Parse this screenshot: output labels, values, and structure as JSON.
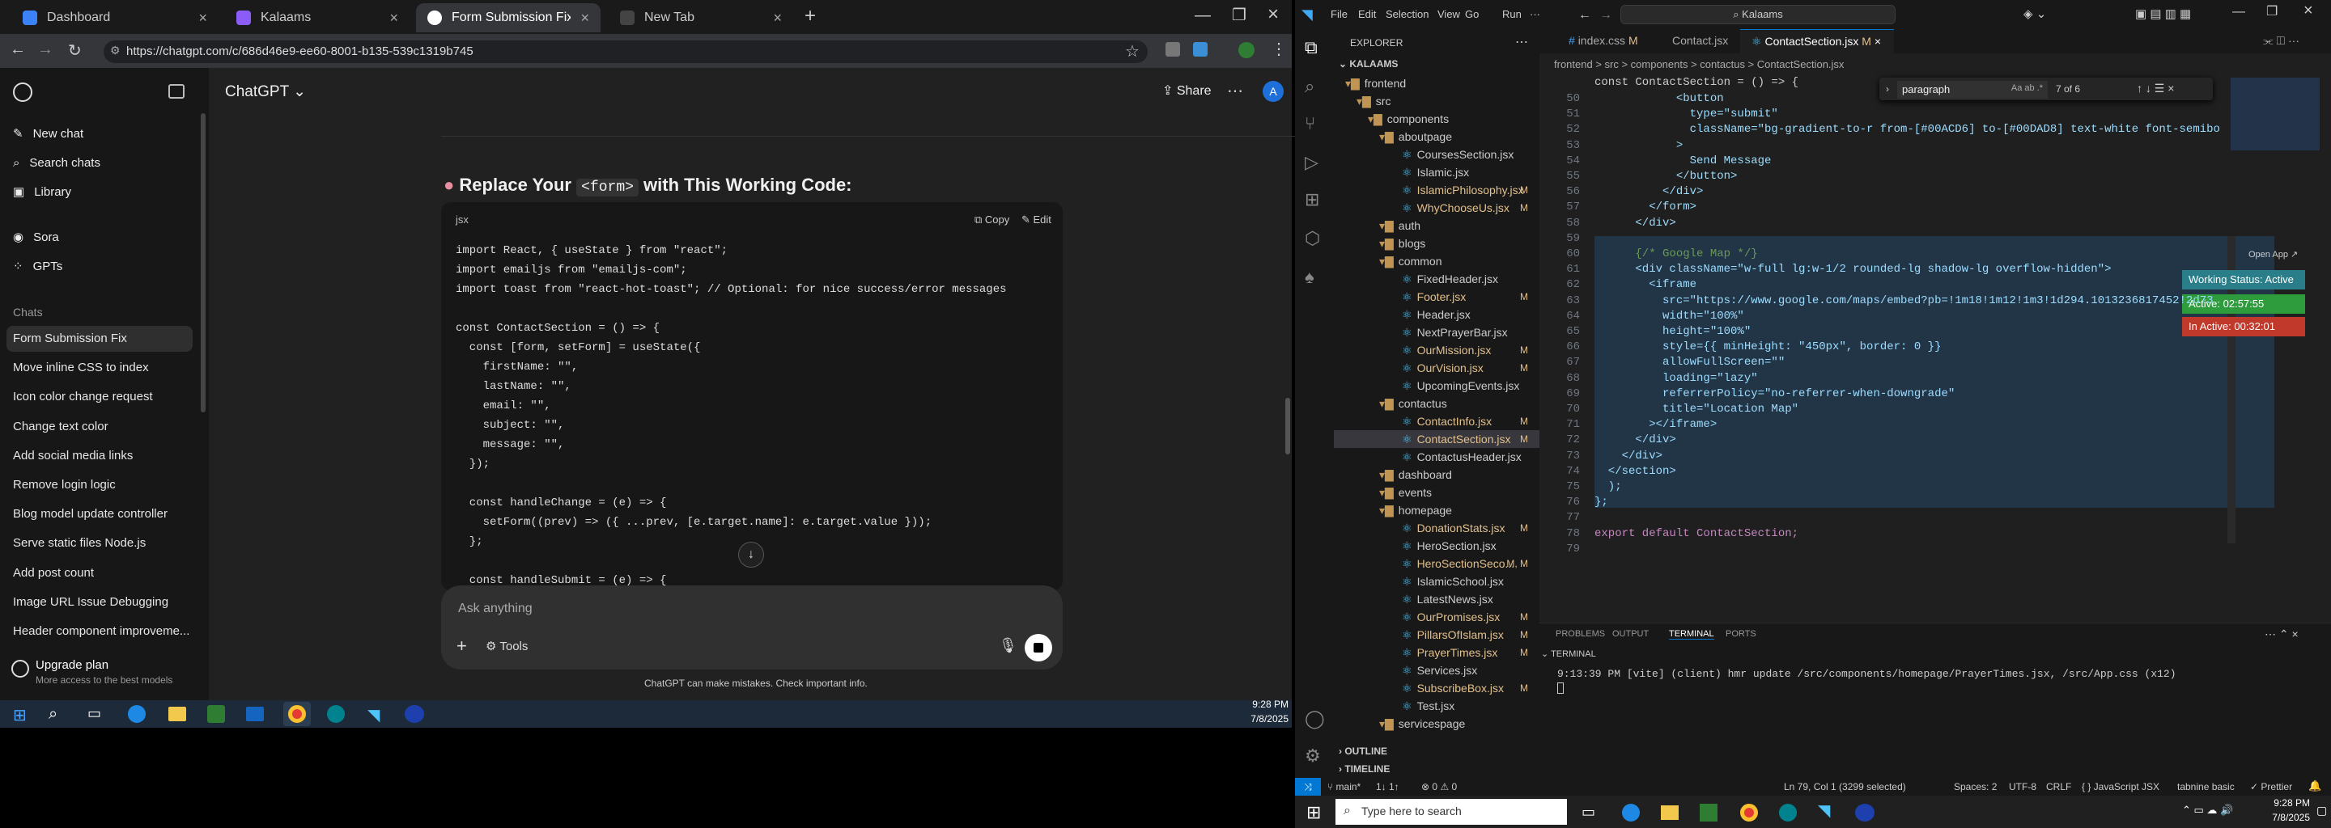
{
  "browser": {
    "tabs": [
      {
        "label": "Dashboard",
        "active": false
      },
      {
        "label": "Kalaams",
        "active": false
      },
      {
        "label": "Form Submission Fix",
        "active": true
      },
      {
        "label": "New Tab",
        "active": false
      }
    ],
    "url": "https://chatgpt.com/c/686d46e9-ee60-8001-b135-539c1319b745"
  },
  "chatgpt": {
    "model": "ChatGPT",
    "share_label": "Share",
    "avatar": "A",
    "nav": [
      {
        "label": "New chat",
        "icon": "new-chat-icon"
      },
      {
        "label": "Search chats",
        "icon": "search-icon"
      },
      {
        "label": "Library",
        "icon": "library-icon"
      },
      {
        "label": "Sora",
        "icon": "sora-icon"
      },
      {
        "label": "GPTs",
        "icon": "gpts-icon"
      }
    ],
    "chats_heading": "Chats",
    "chats": [
      "Form Submission Fix",
      "Move inline CSS to index",
      "Icon color change request",
      "Change text color",
      "Add social media links",
      "Remove login logic",
      "Blog model update controller",
      "Serve static files Node.js",
      "Add post count",
      "Image URL Issue Debugging",
      "Header component improveme..."
    ],
    "upgrade_title": "Upgrade plan",
    "upgrade_sub": "More access to the best models",
    "heading_pre": "Replace Your ",
    "heading_code": "<form>",
    "heading_post": " with This Working Code:",
    "code_lang": "jsx",
    "copy_label": "Copy",
    "edit_label": "Edit",
    "code_lines": [
      "import React, { useState } from \"react\";",
      "import emailjs from \"emailjs-com\";",
      "import toast from \"react-hot-toast\"; // Optional: for nice success/error messages",
      "",
      "const ContactSection = () => {",
      "  const [form, setForm] = useState({",
      "    firstName: \"\",",
      "    lastName: \"\",",
      "    email: \"\",",
      "    subject: \"\",",
      "    message: \"\",",
      "  });",
      "",
      "  const handleChange = (e) => {",
      "    setForm((prev) => ({ ...prev, [e.target.name]: e.target.value }));",
      "  };",
      "",
      "  const handleSubmit = (e) => {"
    ],
    "composer_placeholder": "Ask anything",
    "tools_label": "Tools",
    "disclaimer": "ChatGPT can make mistakes. Check important info."
  },
  "taskbar_left": {
    "time": "9:28 PM",
    "date": "7/8/2025"
  },
  "vscode": {
    "title_menu": [
      "File",
      "Edit",
      "Selection",
      "View",
      "Go",
      "Run",
      "···"
    ],
    "search_text": "Kalaams",
    "tabs": [
      {
        "label": "index.css",
        "mark": "M"
      },
      {
        "label": "Contact.jsx",
        "mark": ""
      },
      {
        "label": "ContactSection.jsx",
        "mark": "M"
      }
    ],
    "breadcrumb": "frontend > src > components > contactus > ContactSection.jsx",
    "find_text": "paragraph",
    "find_count": "7 of 6",
    "explorer_title": "EXPLORER",
    "root": "KALAAMS",
    "tree": [
      {
        "label": "frontend",
        "level": 1,
        "folder": true,
        "mark": ""
      },
      {
        "label": "src",
        "level": 2,
        "folder": true,
        "mark": ""
      },
      {
        "label": "components",
        "level": 3,
        "folder": true,
        "mark": ""
      },
      {
        "label": "aboutpage",
        "level": 4,
        "folder": true,
        "mark": ""
      },
      {
        "label": "CoursesSection.jsx",
        "level": 5,
        "folder": false,
        "mark": ""
      },
      {
        "label": "Islamic.jsx",
        "level": 5,
        "folder": false,
        "mark": ""
      },
      {
        "label": "IslamicPhilosophy.jsx",
        "level": 5,
        "folder": false,
        "mark": "M"
      },
      {
        "label": "WhyChooseUs.jsx",
        "level": 5,
        "folder": false,
        "mark": "M"
      },
      {
        "label": "auth",
        "level": 4,
        "folder": true,
        "mark": ""
      },
      {
        "label": "blogs",
        "level": 4,
        "folder": true,
        "mark": ""
      },
      {
        "label": "common",
        "level": 4,
        "folder": true,
        "mark": ""
      },
      {
        "label": "FixedHeader.jsx",
        "level": 5,
        "folder": false,
        "mark": ""
      },
      {
        "label": "Footer.jsx",
        "level": 5,
        "folder": false,
        "mark": "M"
      },
      {
        "label": "Header.jsx",
        "level": 5,
        "folder": false,
        "mark": ""
      },
      {
        "label": "NextPrayerBar.jsx",
        "level": 5,
        "folder": false,
        "mark": ""
      },
      {
        "label": "OurMission.jsx",
        "level": 5,
        "folder": false,
        "mark": "M"
      },
      {
        "label": "OurVision.jsx",
        "level": 5,
        "folder": false,
        "mark": "M"
      },
      {
        "label": "UpcomingEvents.jsx",
        "level": 5,
        "folder": false,
        "mark": ""
      },
      {
        "label": "contactus",
        "level": 4,
        "folder": true,
        "mark": ""
      },
      {
        "label": "ContactInfo.jsx",
        "level": 5,
        "folder": false,
        "mark": "M"
      },
      {
        "label": "ContactSection.jsx",
        "level": 5,
        "folder": false,
        "mark": "M"
      },
      {
        "label": "ContactusHeader.jsx",
        "level": 5,
        "folder": false,
        "mark": ""
      },
      {
        "label": "dashboard",
        "level": 4,
        "folder": true,
        "mark": ""
      },
      {
        "label": "events",
        "level": 4,
        "folder": true,
        "mark": ""
      },
      {
        "label": "homepage",
        "level": 4,
        "folder": true,
        "mark": ""
      },
      {
        "label": "DonationStats.jsx",
        "level": 5,
        "folder": false,
        "mark": "M"
      },
      {
        "label": "HeroSection.jsx",
        "level": 5,
        "folder": false,
        "mark": ""
      },
      {
        "label": "HeroSectionSeco...",
        "level": 5,
        "folder": false,
        "mark": "M, M"
      },
      {
        "label": "IslamicSchool.jsx",
        "level": 5,
        "folder": false,
        "mark": ""
      },
      {
        "label": "LatestNews.jsx",
        "level": 5,
        "folder": false,
        "mark": ""
      },
      {
        "label": "OurPromises.jsx",
        "level": 5,
        "folder": false,
        "mark": "M"
      },
      {
        "label": "PillarsOfIslam.jsx",
        "level": 5,
        "folder": false,
        "mark": "M"
      },
      {
        "label": "PrayerTimes.jsx",
        "level": 5,
        "folder": false,
        "mark": "M"
      },
      {
        "label": "Services.jsx",
        "level": 5,
        "folder": false,
        "mark": ""
      },
      {
        "label": "SubscribeBox.jsx",
        "level": 5,
        "folder": false,
        "mark": "M"
      },
      {
        "label": "Test.jsx",
        "level": 5,
        "folder": false,
        "mark": ""
      },
      {
        "label": "servicespage",
        "level": 4,
        "folder": true,
        "mark": ""
      }
    ],
    "outline": "OUTLINE",
    "timeline": "TIMELINE",
    "editor_lines": [
      {
        "n": "50",
        "t": "            <button"
      },
      {
        "n": "51",
        "t": "              type=\"submit\""
      },
      {
        "n": "52",
        "t": "              className=\"bg-gradient-to-r from-[#00ACD6] to-[#00DAD8] text-white font-semibo"
      },
      {
        "n": "53",
        "t": "            >"
      },
      {
        "n": "54",
        "t": "              Send Message"
      },
      {
        "n": "55",
        "t": "            </button>"
      },
      {
        "n": "56",
        "t": "          </div>"
      },
      {
        "n": "57",
        "t": "        </form>"
      },
      {
        "n": "58",
        "t": "      </div>"
      },
      {
        "n": "59",
        "t": ""
      },
      {
        "n": "60",
        "t": "      {/* Google Map */}"
      },
      {
        "n": "61",
        "t": "      <div className=\"w-full lg:w-1/2 rounded-lg shadow-lg overflow-hidden\">"
      },
      {
        "n": "62",
        "t": "        <iframe"
      },
      {
        "n": "63",
        "t": "          src=\"https://www.google.com/maps/embed?pb=!1m18!1m12!1m3!1d294.1013236817452!2d73"
      },
      {
        "n": "64",
        "t": "          width=\"100%\""
      },
      {
        "n": "65",
        "t": "          height=\"100%\""
      },
      {
        "n": "66",
        "t": "          style={{ minHeight: \"450px\", border: 0 }}"
      },
      {
        "n": "67",
        "t": "          allowFullScreen=\"\""
      },
      {
        "n": "68",
        "t": "          loading=\"lazy\""
      },
      {
        "n": "69",
        "t": "          referrerPolicy=\"no-referrer-when-downgrade\""
      },
      {
        "n": "70",
        "t": "          title=\"Location Map\""
      },
      {
        "n": "71",
        "t": "        ></iframe>"
      },
      {
        "n": "72",
        "t": "      </div>"
      },
      {
        "n": "73",
        "t": "    </div>"
      },
      {
        "n": "74",
        "t": "  </section>"
      },
      {
        "n": "75",
        "t": "  );"
      },
      {
        "n": "76",
        "t": "};"
      },
      {
        "n": "77",
        "t": ""
      },
      {
        "n": "78",
        "t": "export default ContactSection;"
      },
      {
        "n": "79",
        "t": ""
      }
    ],
    "sticky_header": "const ContactSection = () => {",
    "open_app": "Open App",
    "badges": [
      {
        "label": "Working Status: Active",
        "color": "#2a7e8a"
      },
      {
        "label": "Active: 02:57:55",
        "color": "#2e9b3d"
      },
      {
        "label": "In Active: 00:32:01",
        "color": "#c0392b"
      }
    ],
    "panel_tabs": [
      "PROBLEMS",
      "OUTPUT",
      "TERMINAL",
      "PORTS"
    ],
    "terminal_heading": "TERMINAL",
    "terminal_line": "9:13:39 PM [vite] (client) hmr update /src/components/homepage/PrayerTimes.jsx, /src/App.css (x12)",
    "status": {
      "branch": "main*",
      "sync": "1↓ 1↑",
      "problems": "⊗ 0 ⚠ 0",
      "position": "Ln 79, Col 1 (3299 selected)",
      "spaces": "Spaces: 2",
      "encoding": "UTF-8",
      "eol": "CRLF",
      "language": "{ } JavaScript JSX",
      "tabnine": "tabnine basic",
      "prettier": "✓ Prettier"
    }
  },
  "taskbar_right": {
    "search": "Type here to search",
    "time": "9:28 PM",
    "date": "7/8/2025"
  }
}
